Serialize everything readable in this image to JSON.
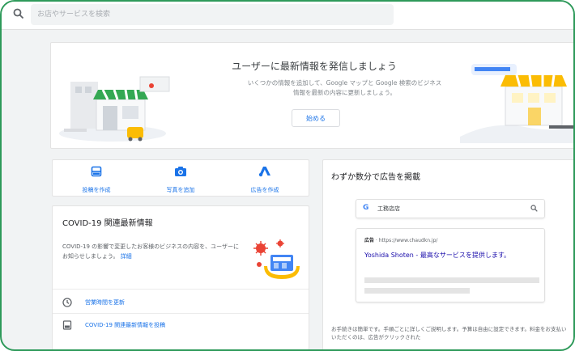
{
  "search": {
    "placeholder": "お店やサービスを検索"
  },
  "banner": {
    "title": "ユーザーに最新情報を発信しましょう",
    "description": "いくつかの情報を追加して、Google マップと Google 検索のビジネス情報を最新の内容に更新しましょう。",
    "button_label": "始める"
  },
  "actions": [
    {
      "label": "投稿を作成",
      "icon": "post-icon"
    },
    {
      "label": "写真を追加",
      "icon": "camera-icon"
    },
    {
      "label": "広告を作成",
      "icon": "google-ads-icon"
    }
  ],
  "covid": {
    "title": "COVID-19 関連最新情報",
    "body": "COVID-19 の影響で変更したお客様のビジネスの内容を、ユーザーにお知らせしましょう。",
    "link": "詳細",
    "rows": [
      {
        "label": "営業時間を更新",
        "icon": "clock-icon"
      },
      {
        "label": "COVID-19 関連最新情報を投稿",
        "icon": "post-icon"
      }
    ]
  },
  "ads": {
    "title": "わずか数分で広告を掲載",
    "preview_query": "工務店店",
    "ad_label": "広告",
    "ad_url": "https://www.chaudkn.jp/",
    "ad_headline": "Yoshida Shoten - 最高なサービスを提供します。",
    "footer": "お手続きは簡単です。手順ごとに詳しくご説明します。予算は自由に設定できます。料金をお支払いいただくのは、広告がクリックされた"
  },
  "colors": {
    "accent": "#1a73e8",
    "frame": "#2e9a5a",
    "background": "#f1f3f4"
  }
}
